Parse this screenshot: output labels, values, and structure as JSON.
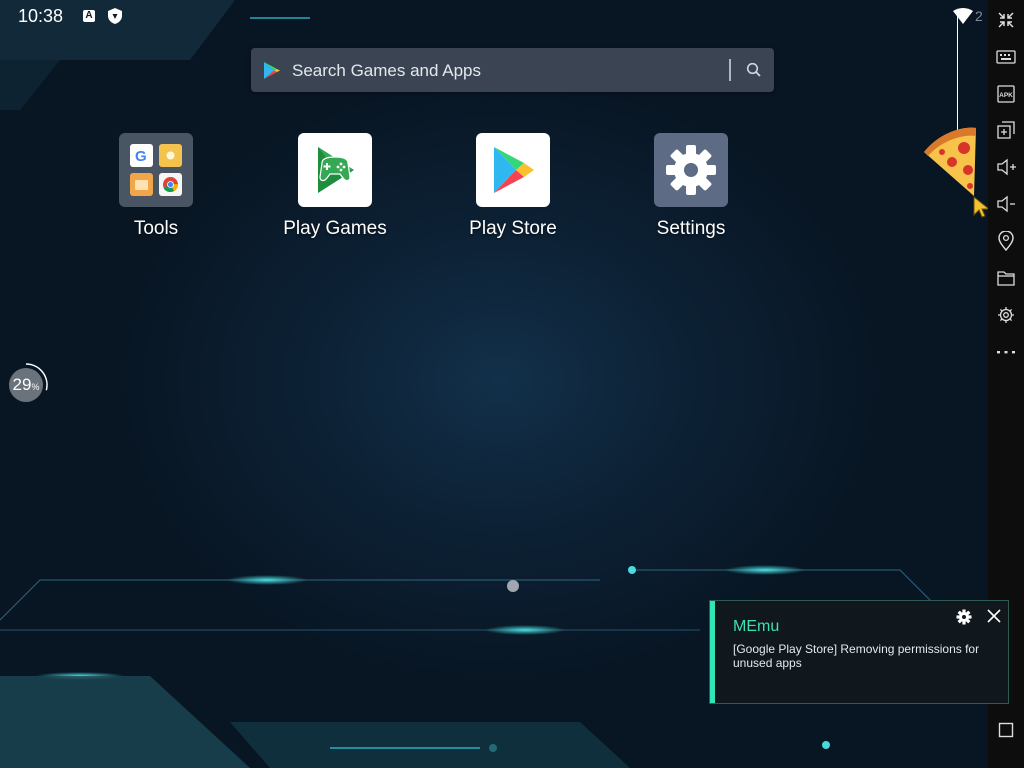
{
  "status_bar": {
    "time": "10:38",
    "badge_letter": "A",
    "signal_digit": "2",
    "icons": [
      "a-badge-icon",
      "shield-icon",
      "wifi-icon"
    ]
  },
  "search": {
    "placeholder": "Search Games and Apps",
    "icons": [
      "play-store-logo-icon",
      "search-icon"
    ]
  },
  "apps": [
    {
      "label": "Tools",
      "icon": "tools-folder-icon"
    },
    {
      "label": "Play Games",
      "icon": "play-games-icon"
    },
    {
      "label": "Play Store",
      "icon": "play-store-icon"
    },
    {
      "label": "Settings",
      "icon": "settings-gear-icon"
    }
  ],
  "boost": {
    "value": "29",
    "unit": "%",
    "progress": 0.29
  },
  "toolbar": {
    "icons": [
      "collapse-icon",
      "keyboard-icon",
      "apk-icon",
      "multi-window-icon",
      "volume-up-icon",
      "volume-down-icon",
      "location-icon",
      "folder-icon",
      "settings-icon",
      "more-icon",
      "recent-apps-icon"
    ],
    "apk_label": "APK"
  },
  "notification": {
    "title": "MEmu",
    "body": "[Google Play Store] Removing permissions for unused apps",
    "icons": [
      "gear-icon",
      "close-icon"
    ]
  },
  "colors": {
    "accent_teal": "#33e5b4",
    "desktop_bg": "#0b1b2c",
    "toolbar_bg": "#0d0d0d"
  }
}
